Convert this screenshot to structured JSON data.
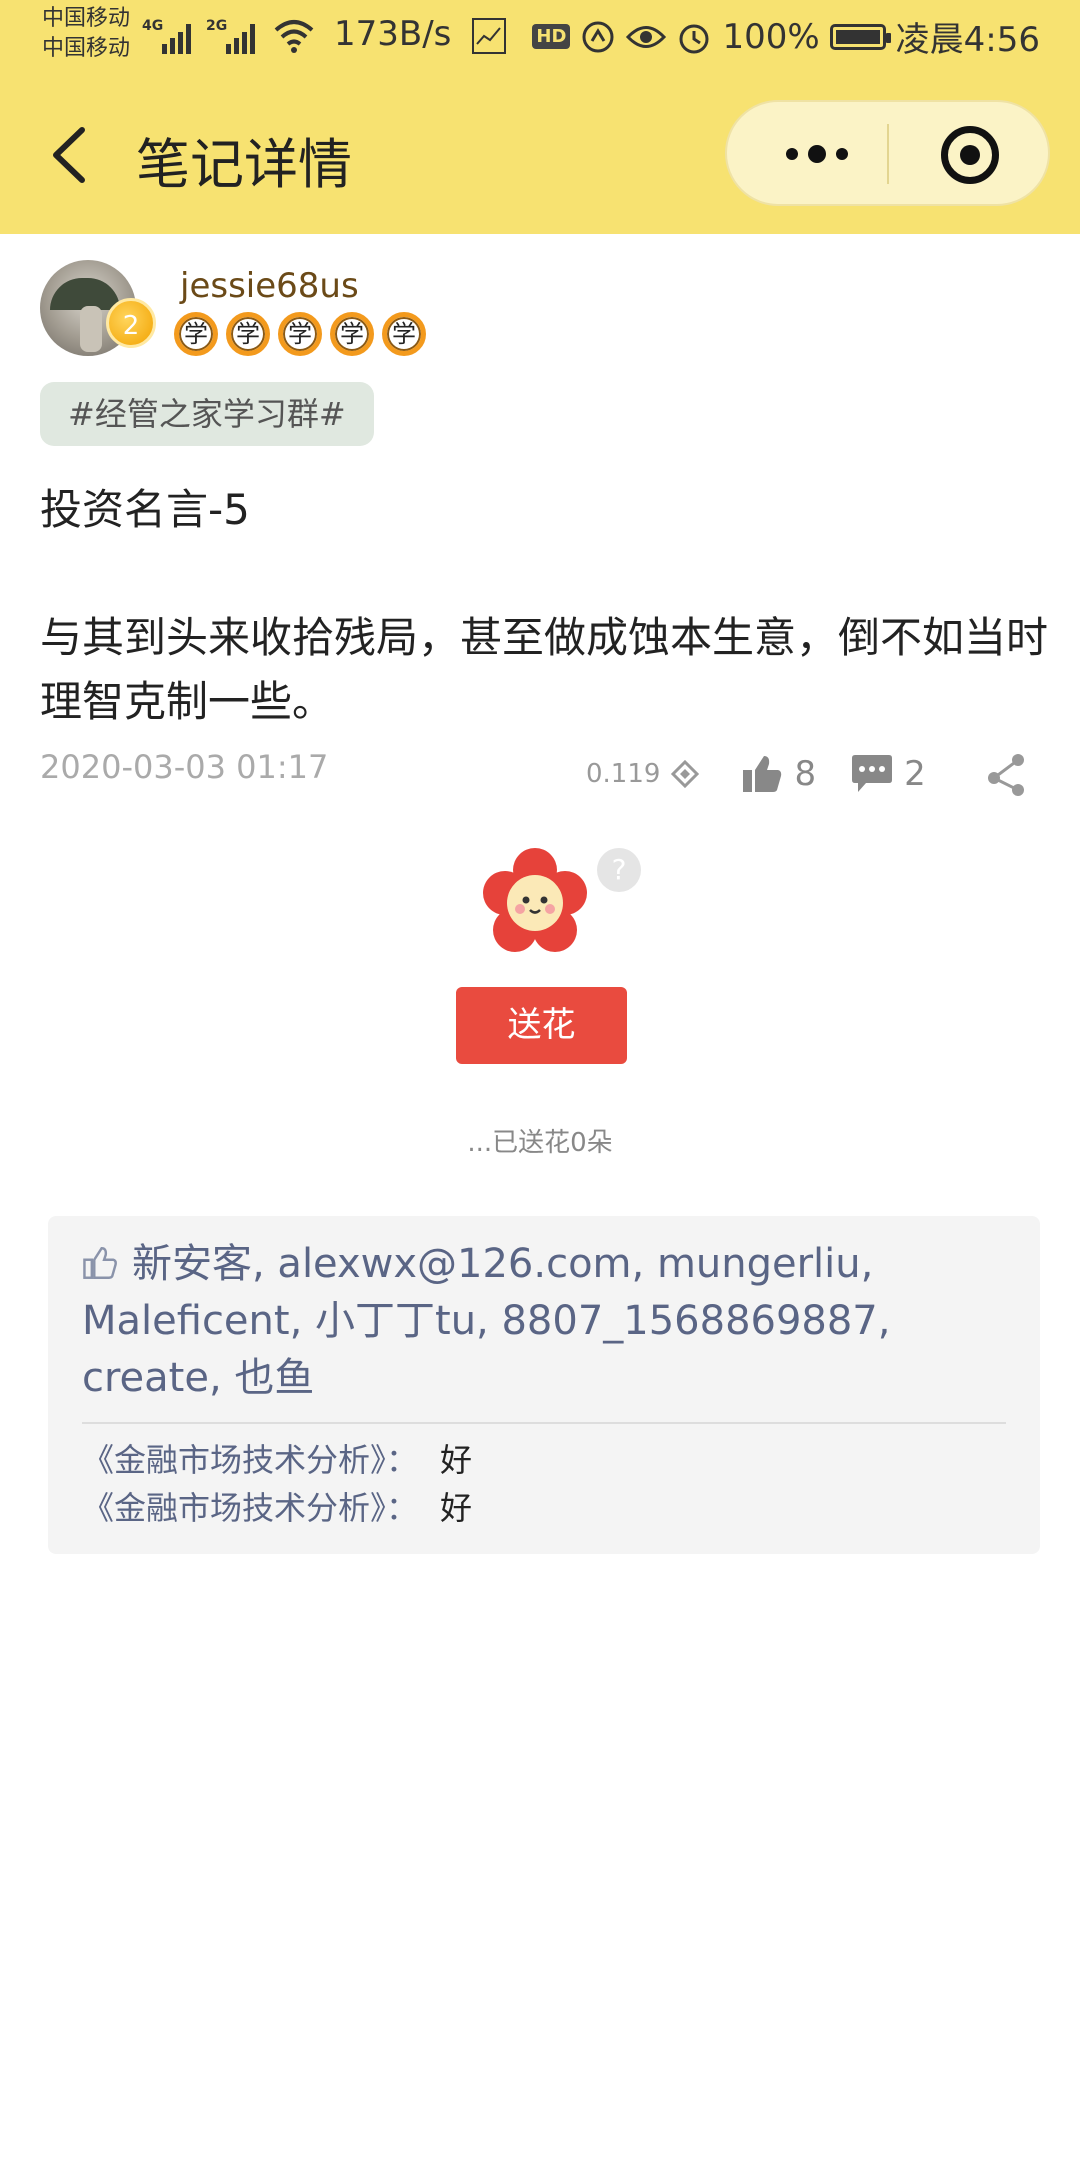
{
  "status_bar": {
    "carrier_1": "中国移动",
    "carrier_2": "中国移动",
    "net_1": "4G",
    "net_2": "2G",
    "speed": "173B/s",
    "hd_badge": "HD",
    "battery": "100%",
    "time": "凌晨4:56"
  },
  "header": {
    "title": "笔记详情"
  },
  "author": {
    "username": "jessie68us",
    "level": "2",
    "medals": [
      "学",
      "学",
      "学",
      "学",
      "学"
    ]
  },
  "post": {
    "tag": "#经管之家学习群#",
    "title": "投资名言-5",
    "body": "与其到头来收拾残局，甚至做成蚀本生意，倒不如当时理智克制一些。",
    "date": "2020-03-03 01:17",
    "value": "0.119",
    "likes": "8",
    "comments": "2"
  },
  "flower": {
    "help": "?",
    "button": "送花",
    "sent": "...已送花0朵"
  },
  "likes_list": "新安客, alexwx@126.com, mungerliu, Maleficent, 小丁丁tu, 8807_1568869887, create, 也鱼",
  "comments": [
    {
      "who": "《金融市场技术分析》：",
      "text": "好"
    },
    {
      "who": "《金融市场技术分析》：",
      "text": "好"
    }
  ],
  "colors": {
    "header_bg": "#f7e271",
    "send_button": "#e94b3f",
    "tag_bg": "#e0e8e0",
    "link_text": "#5a6585"
  }
}
